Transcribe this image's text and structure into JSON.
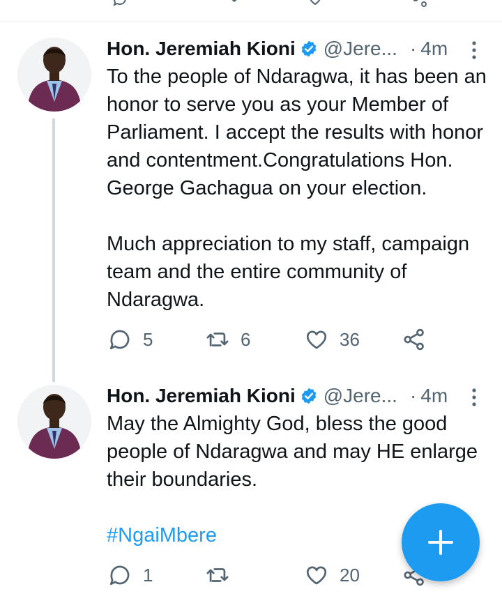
{
  "tweets": [
    {
      "author_name": "Hon. Jeremiah Kioni",
      "handle": "@Jere...",
      "separator": "·",
      "time": "4m",
      "text": "To the people of Ndaragwa, it has been an honor to serve you as your Member of Parliament. I accept the results with honor and contentment.Congratulations Hon. George Gachagua on your election.\n\nMuch appreciation to my staff, campaign team and the entire community of Ndaragwa.",
      "reply_count": "5",
      "retweet_count": "6",
      "like_count": "36"
    },
    {
      "author_name": "Hon. Jeremiah Kioni",
      "handle": "@Jere...",
      "separator": "·",
      "time": "4m",
      "text": "May the Almighty God, bless the good people of Ndaragwa and may HE enlarge their boundaries.",
      "hashtag": "#NgaiMbere",
      "reply_count": "1",
      "retweet_count": "",
      "like_count": "20"
    }
  ],
  "colors": {
    "accent": "#1d9bf0",
    "text": "#0f1419",
    "muted": "#536471",
    "thread_line": "#cfd9de"
  },
  "icons": {
    "verified": "verified-badge-icon",
    "more": "more-vertical-icon",
    "reply": "reply-icon",
    "retweet": "retweet-icon",
    "like": "heart-icon",
    "share": "share-icon",
    "compose": "plus-icon"
  }
}
